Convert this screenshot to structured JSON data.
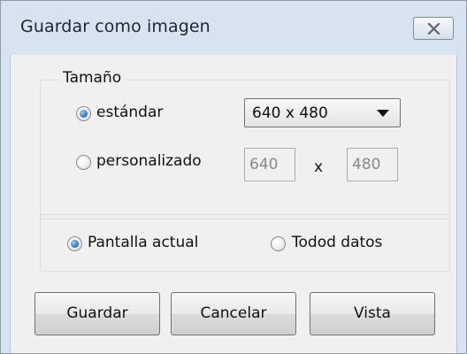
{
  "window": {
    "title": "Guardar como imagen"
  },
  "size_group": {
    "legend": "Tamaño",
    "standard_label": "estándar",
    "custom_label": "personalizado",
    "selected": "estándar",
    "resolution_select": {
      "value": "640 x 480"
    },
    "custom_width": "640",
    "separator": "x",
    "custom_height": "480"
  },
  "scope_group": {
    "current_screen_label": "Pantalla actual",
    "all_data_label": "Todod datos",
    "selected": "Pantalla actual"
  },
  "buttons": {
    "save": "Guardar",
    "cancel": "Cancelar",
    "preview": "Vista"
  },
  "icons": {
    "close": "close-icon",
    "dropdown": "chevron-down-icon",
    "radio_checked": "radio-checked",
    "radio_unchecked": "radio-unchecked"
  },
  "colors": {
    "title_bar": "#d8e3f0",
    "dialog_background": "#f0f0f0",
    "radio_selected": "#2f82d8"
  }
}
